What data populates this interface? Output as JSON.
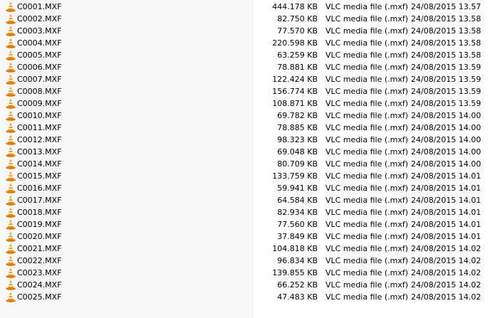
{
  "icon": "vlc-cone-icon",
  "colors": {
    "name_column_bg": "#f7f7f7",
    "cone_orange": "#f28a00",
    "cone_stripe": "#ffffff"
  },
  "files": [
    {
      "name": "C0001.MXF",
      "size": "444.178 KB",
      "type": "VLC media file (.mxf)",
      "date": "24/08/2015 13.57"
    },
    {
      "name": "C0002.MXF",
      "size": "82.750 KB",
      "type": "VLC media file (.mxf)",
      "date": "24/08/2015 13.58"
    },
    {
      "name": "C0003.MXF",
      "size": "77.570 KB",
      "type": "VLC media file (.mxf)",
      "date": "24/08/2015 13.58"
    },
    {
      "name": "C0004.MXF",
      "size": "220.598 KB",
      "type": "VLC media file (.mxf)",
      "date": "24/08/2015 13.58"
    },
    {
      "name": "C0005.MXF",
      "size": "63.259 KB",
      "type": "VLC media file (.mxf)",
      "date": "24/08/2015 13.58"
    },
    {
      "name": "C0006.MXF",
      "size": "78.881 KB",
      "type": "VLC media file (.mxf)",
      "date": "24/08/2015 13.59"
    },
    {
      "name": "C0007.MXF",
      "size": "122.424 KB",
      "type": "VLC media file (.mxf)",
      "date": "24/08/2015 13.59"
    },
    {
      "name": "C0008.MXF",
      "size": "156.774 KB",
      "type": "VLC media file (.mxf)",
      "date": "24/08/2015 13.59"
    },
    {
      "name": "C0009.MXF",
      "size": "108.871 KB",
      "type": "VLC media file (.mxf)",
      "date": "24/08/2015 13.59"
    },
    {
      "name": "C0010.MXF",
      "size": "69.782 KB",
      "type": "VLC media file (.mxf)",
      "date": "24/08/2015 14.00"
    },
    {
      "name": "C0011.MXF",
      "size": "78.885 KB",
      "type": "VLC media file (.mxf)",
      "date": "24/08/2015 14.00"
    },
    {
      "name": "C0012.MXF",
      "size": "98.323 KB",
      "type": "VLC media file (.mxf)",
      "date": "24/08/2015 14.00"
    },
    {
      "name": "C0013.MXF",
      "size": "69.048 KB",
      "type": "VLC media file (.mxf)",
      "date": "24/08/2015 14.00"
    },
    {
      "name": "C0014.MXF",
      "size": "80.709 KB",
      "type": "VLC media file (.mxf)",
      "date": "24/08/2015 14.00"
    },
    {
      "name": "C0015.MXF",
      "size": "133.759 KB",
      "type": "VLC media file (.mxf)",
      "date": "24/08/2015 14.01"
    },
    {
      "name": "C0016.MXF",
      "size": "59.941 KB",
      "type": "VLC media file (.mxf)",
      "date": "24/08/2015 14.01"
    },
    {
      "name": "C0017.MXF",
      "size": "64.584 KB",
      "type": "VLC media file (.mxf)",
      "date": "24/08/2015 14.01"
    },
    {
      "name": "C0018.MXF",
      "size": "82.934 KB",
      "type": "VLC media file (.mxf)",
      "date": "24/08/2015 14.01"
    },
    {
      "name": "C0019.MXF",
      "size": "77.560 KB",
      "type": "VLC media file (.mxf)",
      "date": "24/08/2015 14.01"
    },
    {
      "name": "C0020.MXF",
      "size": "37.849 KB",
      "type": "VLC media file (.mxf)",
      "date": "24/08/2015 14.01"
    },
    {
      "name": "C0021.MXF",
      "size": "104.818 KB",
      "type": "VLC media file (.mxf)",
      "date": "24/08/2015 14.02"
    },
    {
      "name": "C0022.MXF",
      "size": "96.834 KB",
      "type": "VLC media file (.mxf)",
      "date": "24/08/2015 14.02"
    },
    {
      "name": "C0023.MXF",
      "size": "139.855 KB",
      "type": "VLC media file (.mxf)",
      "date": "24/08/2015 14.02"
    },
    {
      "name": "C0024.MXF",
      "size": "66.252 KB",
      "type": "VLC media file (.mxf)",
      "date": "24/08/2015 14.02"
    },
    {
      "name": "C0025.MXF",
      "size": "47.483 KB",
      "type": "VLC media file (.mxf)",
      "date": "24/08/2015 14.02"
    }
  ]
}
